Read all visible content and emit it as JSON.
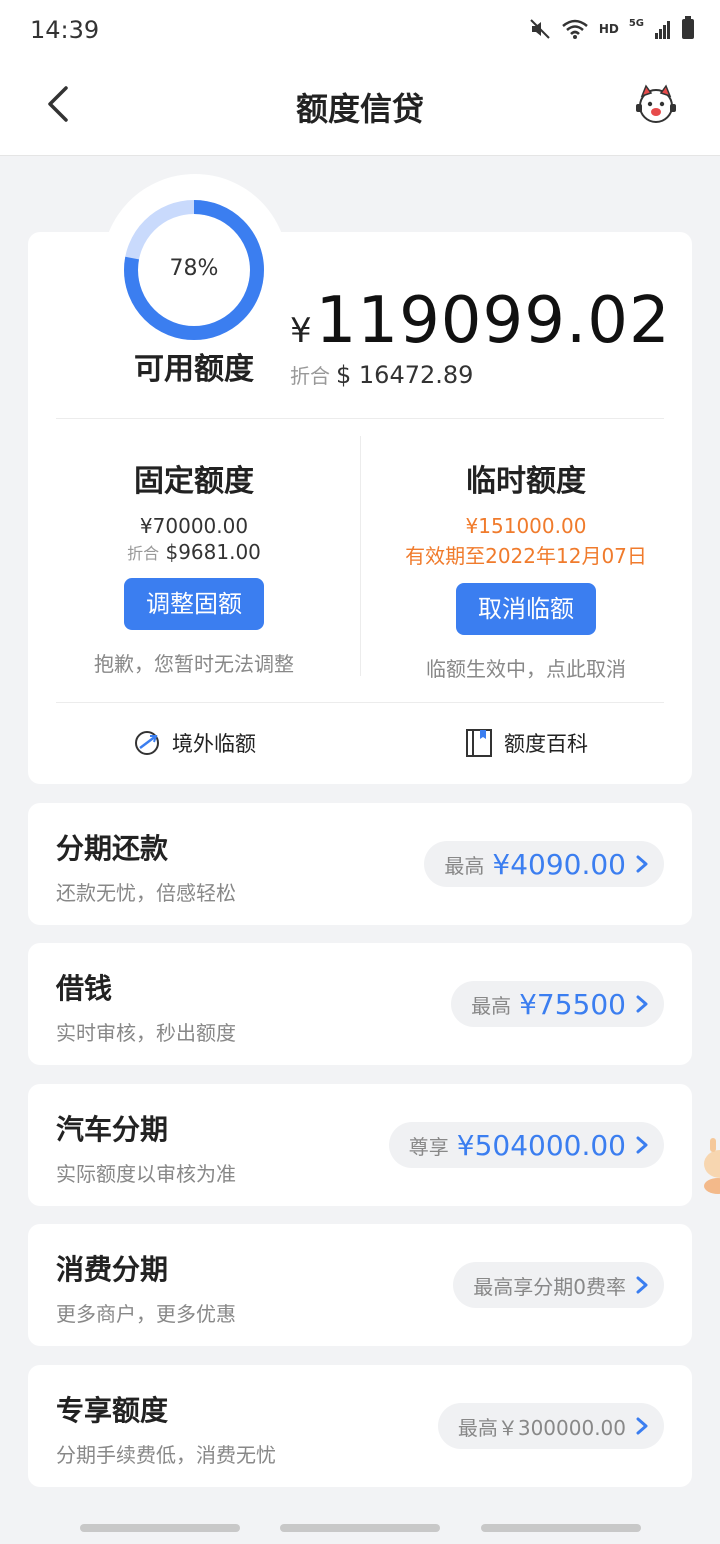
{
  "status_bar": {
    "time": "14:39",
    "network_hd": "HD",
    "network_5g": "5G"
  },
  "nav": {
    "title": "额度信贷"
  },
  "summary": {
    "ring_percent": "78%",
    "ring_fraction": 0.78,
    "available_label": "可用额度",
    "currency_symbol": "¥",
    "available_amount": "119099.02",
    "converted_label": "折合",
    "converted_amount": "$ 16472.89"
  },
  "fixed_limit": {
    "title": "固定额度",
    "amount": "¥70000.00",
    "converted_label": "折合",
    "converted_amount": "$9681.00",
    "button": "调整固额",
    "note": "抱歉，您暂时无法调整"
  },
  "temp_limit": {
    "title": "临时额度",
    "amount": "¥151000.00",
    "validity": "有效期至2022年12月07日",
    "button": "取消临额",
    "note": "临额生效中，点此取消"
  },
  "links": {
    "overseas": "境外临额",
    "wiki": "额度百科"
  },
  "products": [
    {
      "title": "分期还款",
      "subtitle": "还款无忧，倍感轻松",
      "prefix": "最高",
      "amount": "¥4090.00"
    },
    {
      "title": "借钱",
      "subtitle": "实时审核，秒出额度",
      "prefix": "最高",
      "amount": "¥75500"
    },
    {
      "title": "汽车分期",
      "subtitle": "实际额度以审核为准",
      "prefix": "尊享",
      "amount": "¥504000.00"
    },
    {
      "title": "消费分期",
      "subtitle": "更多商户，更多优惠",
      "prefix": "最高享分期0费率",
      "amount": ""
    },
    {
      "title": "专享额度",
      "subtitle": "分期手续费低，消费无忧",
      "prefix": "最高￥300000.00",
      "amount": ""
    }
  ],
  "colors": {
    "accent": "#3b7ef0",
    "orange": "#f07b2c",
    "ring_track": "#c9dafc"
  }
}
